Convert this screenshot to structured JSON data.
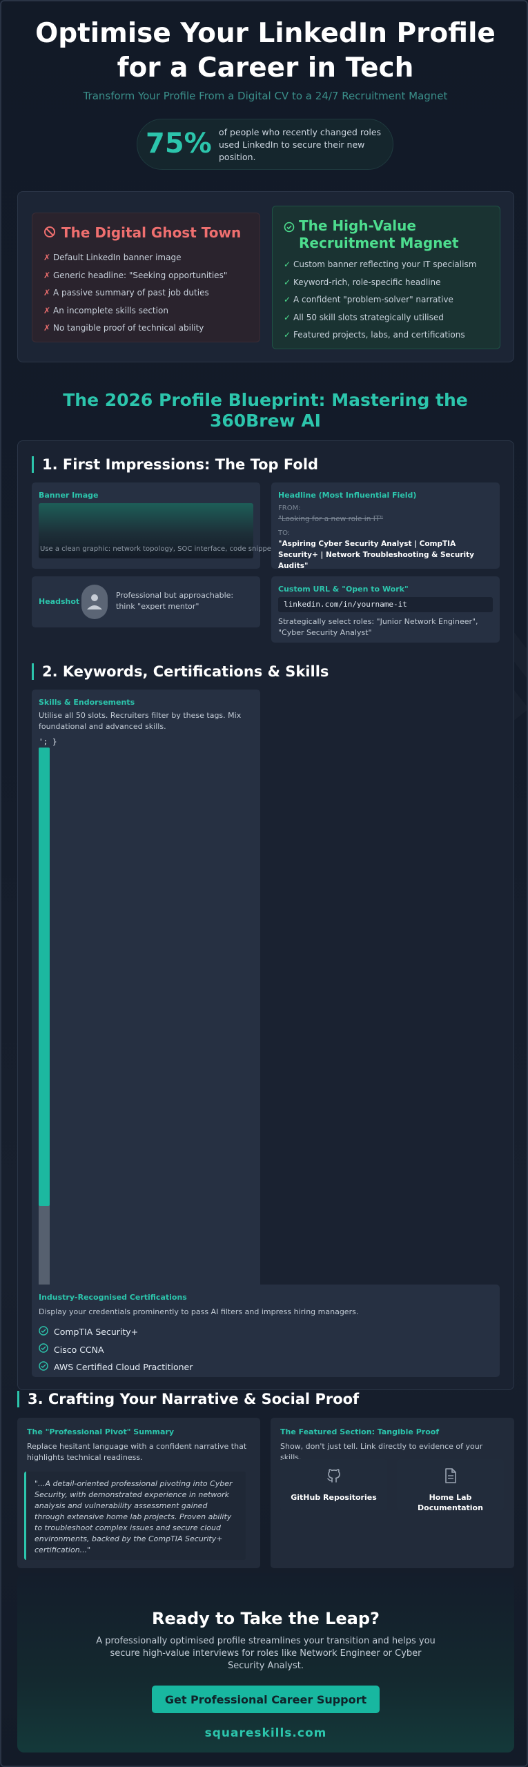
{
  "hero": {
    "title": "Optimise Your LinkedIn Profile for a Career in Tech",
    "subtitle": "Transform Your Profile From a Digital CV to a 24/7 Recruitment Magnet",
    "stat_value": "75%",
    "stat_text": "of people who recently changed roles used LinkedIn to secure their new position."
  },
  "ghost_town": {
    "title": "The Digital Ghost Town",
    "icon": "ban-icon",
    "items": [
      "Default LinkedIn banner image",
      "Generic headline: \"Seeking opportunities\"",
      "A passive summary of past job duties",
      "An incomplete skills section",
      "No tangible proof of technical ability"
    ]
  },
  "magnet": {
    "title": "The High-Value Recruitment Magnet",
    "icon": "check-circle-icon",
    "items": [
      "Custom banner reflecting your IT specialism",
      "Keyword-rich, role-specific headline",
      "A confident \"problem-solver\" narrative",
      "All 50 skill slots strategically utilised",
      "Featured projects, labs, and certifications"
    ]
  },
  "blueprint": {
    "title": "The 2026 Profile Blueprint: Mastering the 360Brew AI"
  },
  "section1": {
    "title": "1. First Impressions: The Top Fold",
    "banner": {
      "label": "Banner Image",
      "hint": "Use a clean graphic: network topology, SOC interface, code snippet"
    },
    "headline": {
      "label": "Headline (Most Influential Field)",
      "from_label": "FROM:",
      "from_value": "\"Looking for a new role in IT\"",
      "to_label": "TO:",
      "to_value": "\"Aspiring Cyber Security Analyst | CompTIA Security+ | Network Troubleshooting & Security Audits\""
    },
    "headshot": {
      "label": "Headshot",
      "text": "Professional but approachable: think \"expert mentor\""
    },
    "url": {
      "label": "Custom URL & \"Open to Work\"",
      "value": "linkedin.com/in/yourname-it",
      "text": "Strategically select roles: \"Junior Network Engineer\", \"Cyber Security Analyst\""
    }
  },
  "section2": {
    "title": "2. Keywords, Certifications & Skills",
    "skills": {
      "label": "Skills & Endorsements",
      "text": "Utilise all 50 slots. Recruiters filter by these tags. Mix foundational and advanced skills.",
      "code": "'; }",
      "slots_used_fraction": 0.84
    },
    "certs": {
      "label": "Industry-Recognised Certifications",
      "text": "Display your credentials prominently to pass AI filters and impress hiring managers.",
      "items": [
        "CompTIA Security+",
        "Cisco CCNA",
        "AWS Certified Cloud Practitioner"
      ]
    }
  },
  "section3": {
    "title": "3. Crafting Your Narrative & Social Proof",
    "summary": {
      "label": "The \"Professional Pivot\" Summary",
      "text": "Replace hesitant language with a confident narrative that highlights technical readiness.",
      "quote": "\"...A detail-oriented professional pivoting into Cyber Security, with demonstrated experience in network analysis and vulnerability assessment gained through extensive home lab projects. Proven ability to troubleshoot complex issues and secure cloud environments, backed by the CompTIA Security+ certification...\""
    },
    "featured": {
      "label": "The Featured Section: Tangible Proof",
      "text": "Show, don't just tell. Link directly to evidence of your skills.",
      "cards": [
        {
          "icon": "github-icon",
          "label": "GitHub Repositories"
        },
        {
          "icon": "document-icon",
          "label": "Home Lab Documentation"
        }
      ]
    }
  },
  "cta": {
    "title": "Ready to Take the Leap?",
    "text": "A professionally optimised profile streamlines your transition and helps you secure high-value interviews for roles like Network Engineer or Cyber Security Analyst.",
    "button": "Get Professional Career Support",
    "footer": "squareskills.com"
  },
  "colors": {
    "accent": "#2cc5ac",
    "danger": "#ef6f6f",
    "success": "#4ddd8e",
    "background": "#121a27"
  }
}
